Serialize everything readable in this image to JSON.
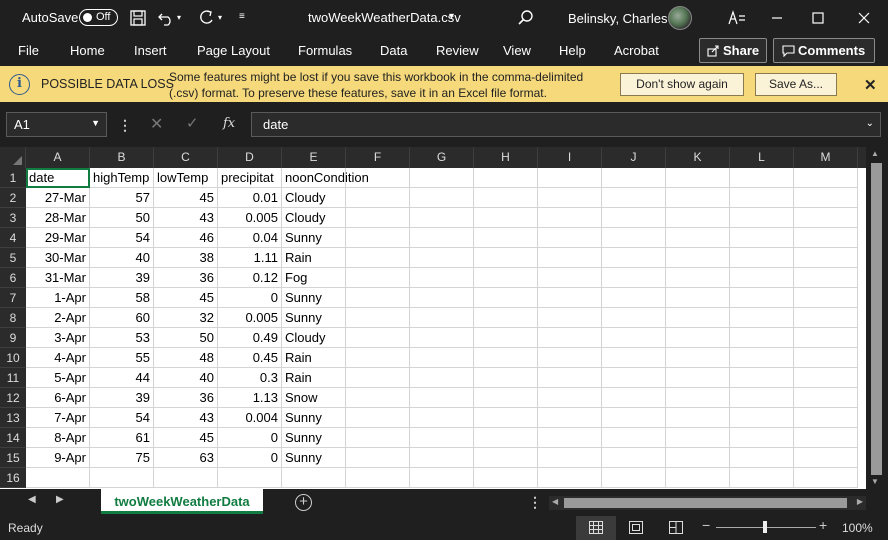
{
  "titlebar": {
    "autosave_label": "AutoSave",
    "autosave_state": "Off",
    "filename": "twoWeekWeatherData.csv",
    "user_name": "Belinsky, Charles"
  },
  "menu": {
    "items": [
      "File",
      "Home",
      "Insert",
      "Page Layout",
      "Formulas",
      "Data",
      "Review",
      "View",
      "Help",
      "Acrobat"
    ],
    "share_label": "Share",
    "comments_label": "Comments"
  },
  "message_bar": {
    "title": "POSSIBLE DATA LOSS",
    "line1": "Some features might be lost if you save this workbook in the comma-delimited",
    "line2": "(.csv) format. To preserve these features, save it in an Excel file format.",
    "dont_show_label": "Don't show again",
    "save_as_label": "Save As..."
  },
  "formula_bar": {
    "name_box": "A1",
    "fx_label": "fx",
    "formula": "date"
  },
  "columns": [
    "A",
    "B",
    "C",
    "D",
    "E",
    "F",
    "G",
    "H",
    "I",
    "J",
    "K",
    "L",
    "M"
  ],
  "rows": [
    [
      "date",
      "highTemp",
      "lowTemp",
      "precipitat",
      "noonCondition"
    ],
    [
      "27-Mar",
      "57",
      "45",
      "0.01",
      "Cloudy"
    ],
    [
      "28-Mar",
      "50",
      "43",
      "0.005",
      "Cloudy"
    ],
    [
      "29-Mar",
      "54",
      "46",
      "0.04",
      "Sunny"
    ],
    [
      "30-Mar",
      "40",
      "38",
      "1.11",
      "Rain"
    ],
    [
      "31-Mar",
      "39",
      "36",
      "0.12",
      "Fog"
    ],
    [
      "1-Apr",
      "58",
      "45",
      "0",
      "Sunny"
    ],
    [
      "2-Apr",
      "60",
      "32",
      "0.005",
      "Sunny"
    ],
    [
      "3-Apr",
      "53",
      "50",
      "0.49",
      "Cloudy"
    ],
    [
      "4-Apr",
      "55",
      "48",
      "0.45",
      "Rain"
    ],
    [
      "5-Apr",
      "44",
      "40",
      "0.3",
      "Rain"
    ],
    [
      "6-Apr",
      "39",
      "36",
      "1.13",
      "Snow"
    ],
    [
      "7-Apr",
      "54",
      "43",
      "0.004",
      "Sunny"
    ],
    [
      "8-Apr",
      "61",
      "45",
      "0",
      "Sunny"
    ],
    [
      "9-Apr",
      "75",
      "63",
      "0",
      "Sunny"
    ],
    [
      "",
      "",
      "",
      "",
      ""
    ]
  ],
  "sheet_tab": "twoWeekWeatherData",
  "status": {
    "ready": "Ready",
    "zoom": "100%"
  },
  "colors": {
    "excel_green": "#107c41",
    "message_bar": "#f5d97b",
    "dark_bg": "#1f1f1f"
  }
}
